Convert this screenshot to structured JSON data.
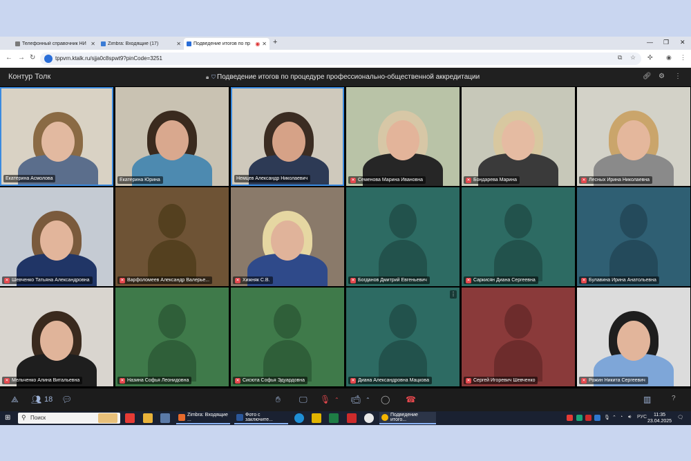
{
  "browser": {
    "tabs": [
      {
        "label": "Телефонный справочник НИ",
        "active": false,
        "favicon_color": "#7a7a7a"
      },
      {
        "label": "Zimbra: Входящие (17)",
        "active": false,
        "favicon_color": "#3a7bd5"
      },
      {
        "label": "Подведение итогов по пр",
        "active": true,
        "favicon_color": "#2a6ed8"
      }
    ],
    "new_tab_glyph": "+",
    "url": "tppvrn.ktalk.ru/sjja0c8spwt9?pinCode=3251"
  },
  "app": {
    "name": "Контур Толк",
    "meeting_title": "Подведение итогов по процедуре профессионально-общественной аккредитации"
  },
  "participants": [
    {
      "name": "Екатерина Асмолова",
      "muted": false,
      "speaking": true,
      "video": true,
      "bg": "#d9d2c4",
      "skin": "#e2b9a0",
      "hair": "#8a6a44",
      "cloth": "#5b6e8c"
    },
    {
      "name": "Екатерина Юрина",
      "muted": false,
      "speaking": false,
      "video": true,
      "bg": "#c9c2b2",
      "skin": "#d9a88e",
      "hair": "#3a2a1e",
      "cloth": "#4d8ab0"
    },
    {
      "name": "Немцев Александр Николаевич",
      "muted": false,
      "speaking": true,
      "video": true,
      "bg": "#cfc9bc",
      "skin": "#d6a287",
      "hair": "#3b2c22",
      "cloth": "#2d3a55"
    },
    {
      "name": "Семенова Марина Ивановна",
      "muted": true,
      "speaking": false,
      "video": true,
      "bg": "#b9c3a7",
      "skin": "#e3b49a",
      "hair": "#d7c7a6",
      "cloth": "#262626"
    },
    {
      "name": "Бондарева Марина",
      "muted": true,
      "speaking": false,
      "video": true,
      "bg": "#c7c8b9",
      "skin": "#e5bba2",
      "hair": "#d8c8a0",
      "cloth": "#3a3a3a"
    },
    {
      "name": "Лесных Ирина Николаевна",
      "muted": true,
      "speaking": false,
      "video": true,
      "bg": "#d3d2c8",
      "skin": "#e4b79c",
      "hair": "#caa56b",
      "cloth": "#8a8a8a"
    },
    {
      "name": "Шевченко Татьяна Александровна",
      "muted": true,
      "speaking": false,
      "video": true,
      "bg": "#c5cbd3",
      "skin": "#e2b59b",
      "hair": "#7a5a3c",
      "cloth": "#203566"
    },
    {
      "name": "Варфоломеев Александр Валерье...",
      "muted": true,
      "speaking": false,
      "video": false,
      "bg": "#6e5335",
      "sil": "#54401f"
    },
    {
      "name": "Хижняк С.В.",
      "muted": true,
      "speaking": false,
      "video": true,
      "bg": "#8a7a6a",
      "skin": "#e0b39a",
      "hair": "#e6d7a2",
      "cloth": "#2f4a8a"
    },
    {
      "name": "Богданов Дмитрий Евгеньевич",
      "muted": true,
      "speaking": false,
      "video": false,
      "bg": "#2d6b63",
      "sil": "#22524c"
    },
    {
      "name": "Саркисян Диана Сергеевна",
      "muted": true,
      "speaking": false,
      "video": false,
      "bg": "#2d6b63",
      "sil": "#22524c"
    },
    {
      "name": "Булавина Ирина Анатольевна",
      "muted": true,
      "speaking": false,
      "video": false,
      "bg": "#2f5f73",
      "sil": "#244a5b"
    },
    {
      "name": "Мельченко Алина Витальевна",
      "muted": true,
      "speaking": false,
      "video": true,
      "bg": "#d9d5cf",
      "skin": "#e0b49a",
      "hair": "#3a2a1e",
      "cloth": "#1e1e1e"
    },
    {
      "name": "Назина Софья Леонидовна",
      "muted": true,
      "speaking": false,
      "video": false,
      "bg": "#3f7a4a",
      "sil": "#2f5f39"
    },
    {
      "name": "Сисюта Софья Эдуардовна",
      "muted": true,
      "speaking": false,
      "video": false,
      "bg": "#3f7a4a",
      "sil": "#2f5f39"
    },
    {
      "name": "Диана Александровна Мацкова",
      "muted": true,
      "speaking": false,
      "video": false,
      "bg": "#2d6b63",
      "sil": "#22524c",
      "menu": true
    },
    {
      "name": "Сергей Игоревич Шевченко",
      "muted": true,
      "speaking": false,
      "video": false,
      "bg": "#8a3a3a",
      "sil": "#6d2c2c"
    },
    {
      "name": "Рожин Никита Сергеевич",
      "muted": true,
      "speaking": false,
      "video": true,
      "bg": "#dcdcdc",
      "skin": "#e2b59b",
      "hair": "#1e1e1e",
      "cloth": "#7ea6d8"
    }
  ],
  "toolbar": {
    "participant_count": "18"
  },
  "taskbar": {
    "search_placeholder": "Поиск",
    "windows": [
      {
        "label": "Zimbra: Входящие ...",
        "icon_color": "#e66a2c"
      },
      {
        "label": "Фото с заключите...",
        "icon_color": "#2b579a"
      },
      {
        "label": "Подведение итого...",
        "icon_color": "#2a6ed8"
      }
    ],
    "lang": "РУС",
    "time": "11:35",
    "date": "23.04.2025"
  }
}
